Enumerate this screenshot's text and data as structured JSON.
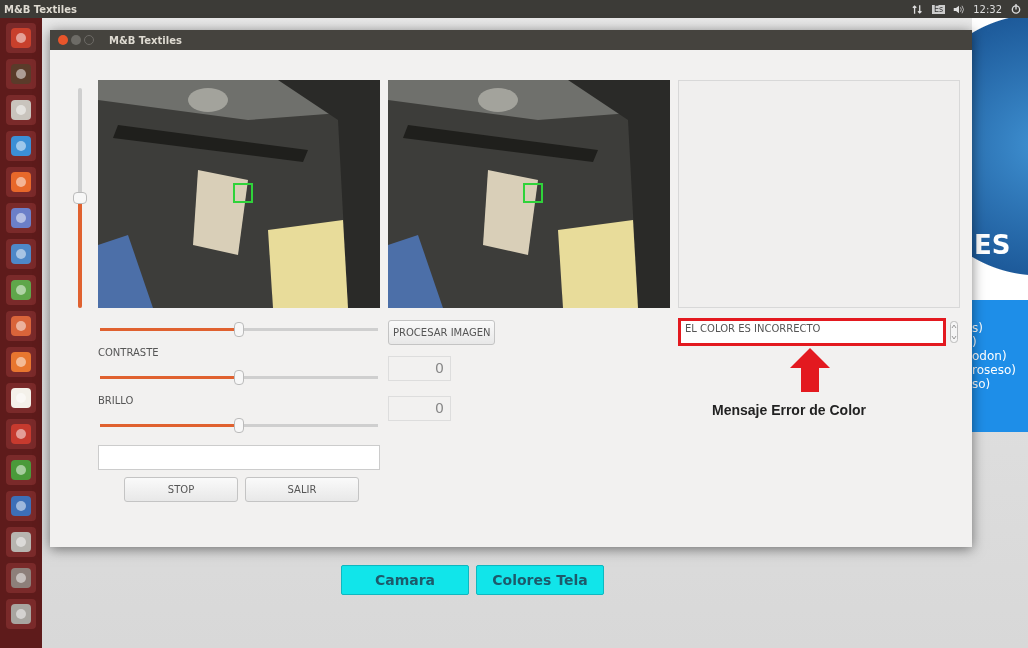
{
  "top_panel": {
    "title": "M&B Textiles",
    "keyboard": "Es",
    "clock": "12:32"
  },
  "background_app": {
    "logo_text": "ES",
    "list_fragments": [
      "s)",
      ")",
      "odon)",
      "roseso)",
      "so)"
    ],
    "buttons": [
      "Camara",
      "Colores Tela"
    ]
  },
  "window": {
    "title": "M&B Textiles",
    "vertical_slider": {
      "level": 0.5
    },
    "zoom_slider": {
      "level": 0.5
    },
    "process_button": "PROCESAR IMAGEN",
    "adjustments": [
      {
        "label": "CONTRASTE",
        "level": 0.5,
        "value": "0"
      },
      {
        "label": "BRILLO",
        "level": 0.5,
        "value": "0"
      }
    ],
    "buttons": [
      "STOP",
      "SALIR"
    ],
    "message_field": {
      "value": "EL COLOR ES INCORRECTO",
      "highlighted": true
    },
    "annotation": "Mensaje Error de Color"
  }
}
